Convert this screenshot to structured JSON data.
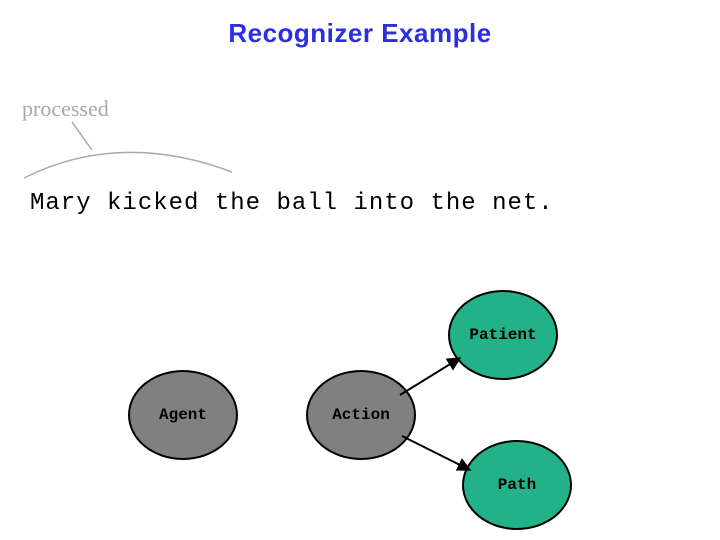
{
  "title": "Recognizer Example",
  "annotation": "processed",
  "sentence": "Mary kicked the ball into the net.",
  "nodes": {
    "agent": {
      "label": "Agent",
      "color": "gray"
    },
    "action": {
      "label": "Action",
      "color": "gray"
    },
    "patient": {
      "label": "Patient",
      "color": "green"
    },
    "path": {
      "label": "Path",
      "color": "green"
    }
  }
}
